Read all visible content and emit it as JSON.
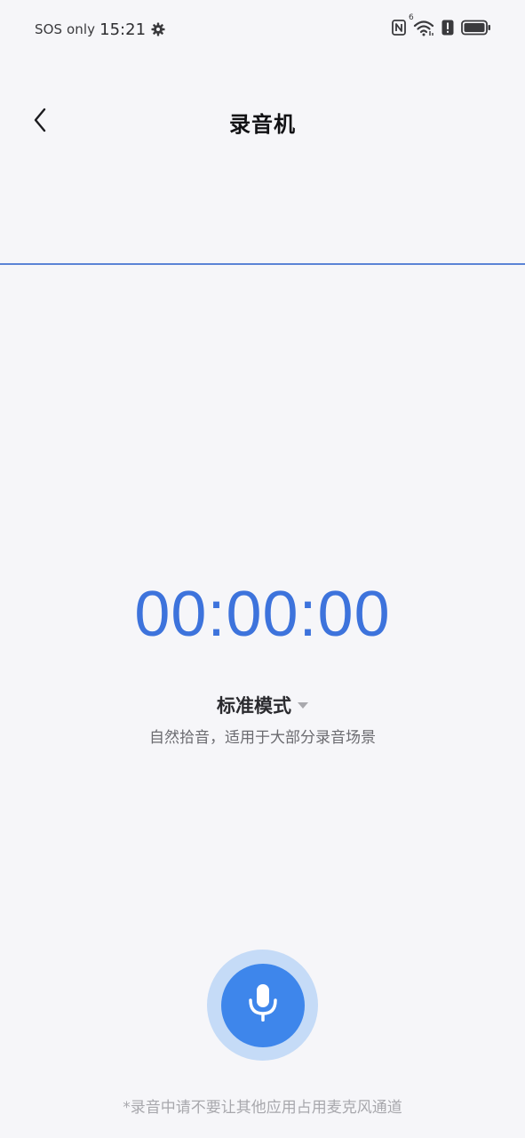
{
  "status_bar": {
    "carrier": "SOS only",
    "time": "15:21",
    "network_label": "6",
    "icons": [
      "settings-gear-icon",
      "nfc-icon",
      "wifi-icon",
      "alert-icon",
      "battery-icon"
    ]
  },
  "header": {
    "title": "录音机",
    "back_icon": "chevron-left-icon"
  },
  "timer": {
    "display": "00:00:00"
  },
  "mode": {
    "label": "标准模式",
    "description": "自然拾音，适用于大部分录音场景"
  },
  "record_button": {
    "icon": "microphone-icon"
  },
  "footer": {
    "note": "*录音中请不要让其他应用占用麦克风通道"
  },
  "colors": {
    "accent": "#3d73dc",
    "record_button": "#3e86eb",
    "record_button_halo": "#c5dbf7",
    "background": "#f6f6f9",
    "divider": "#5b84d6"
  }
}
